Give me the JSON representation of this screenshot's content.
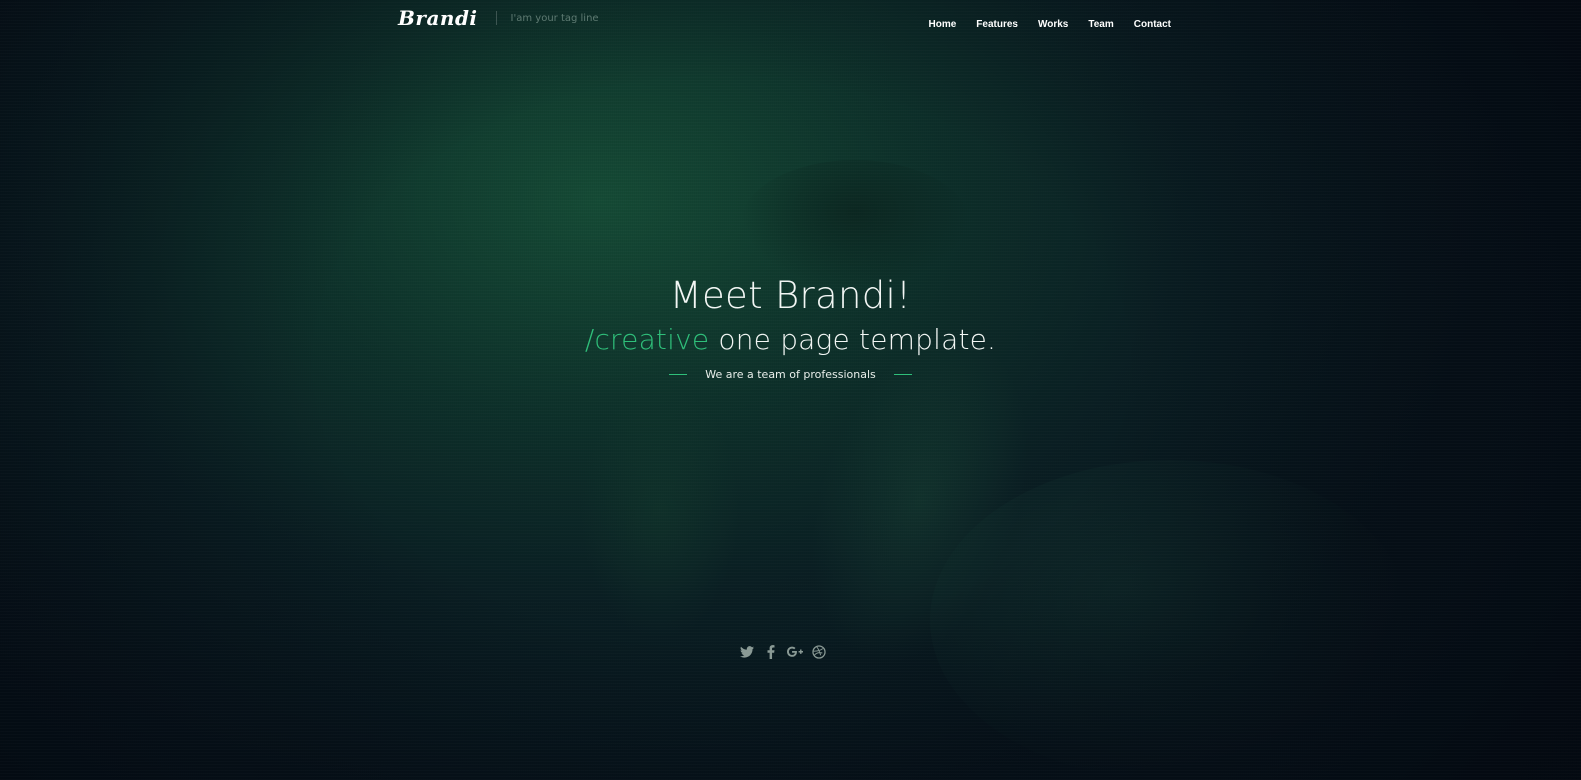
{
  "brand": {
    "logo": "Brandi",
    "tagline": "I'am your tag line"
  },
  "nav": {
    "items": [
      {
        "label": "Home"
      },
      {
        "label": "Features"
      },
      {
        "label": "Works"
      },
      {
        "label": "Team"
      },
      {
        "label": "Contact"
      }
    ]
  },
  "hero": {
    "title": "Meet Brandi!",
    "subtitle_accent": "/creative",
    "subtitle_rest": " one page template.",
    "lead": "We are a team of professionals"
  },
  "social": {
    "icons": [
      "twitter-icon",
      "facebook-icon",
      "google-plus-icon",
      "dribbble-icon"
    ]
  },
  "colors": {
    "accent": "#2fbf7a",
    "text": "#f2f6f4",
    "icon": "#8a9a95",
    "background": "#0e2e28"
  }
}
